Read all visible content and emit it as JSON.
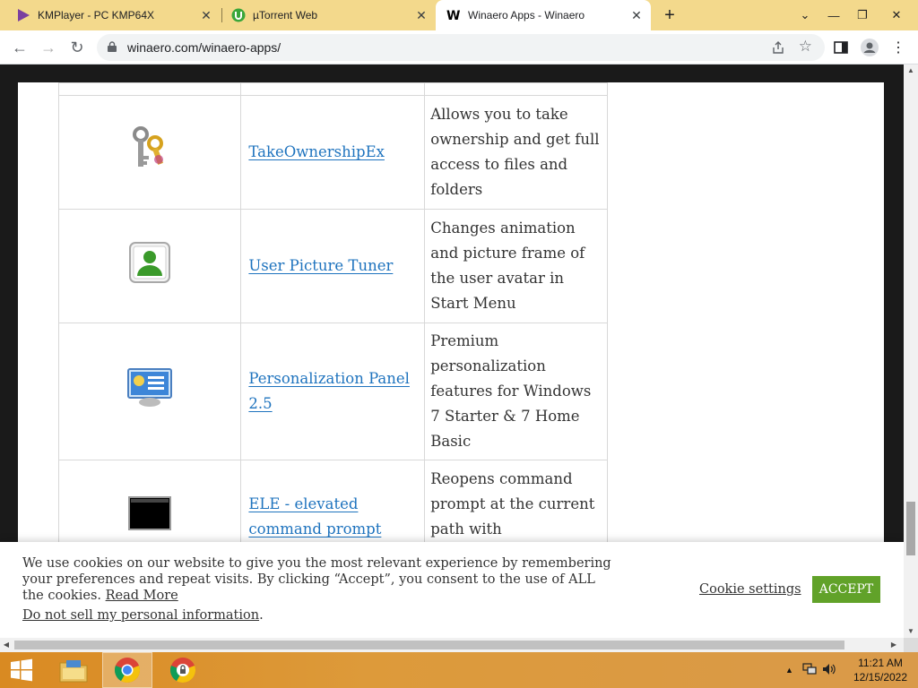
{
  "browser": {
    "tabs": [
      {
        "title": "KMPlayer - PC KMP64X",
        "icon": "kmplayer-icon",
        "active": false
      },
      {
        "title": "µTorrent Web",
        "icon": "utorrent-icon",
        "active": false
      },
      {
        "title": "Winaero Apps - Winaero",
        "icon": "winaero-icon",
        "active": true
      }
    ],
    "new_tab_glyph": "+",
    "url": "winaero.com/winaero-apps/"
  },
  "apps": [
    {
      "name": "TakeOwnershipEx",
      "icon": "keys-icon",
      "description": "Allows you to take ownership and get full access to files and folders"
    },
    {
      "name": "User Picture Tuner",
      "icon": "user-avatar-icon",
      "description": "Changes animation and picture frame of the user avatar in Start Menu"
    },
    {
      "name": "Personalization Panel 2.5",
      "icon": "personalization-panel-icon",
      "description": "Premium personalization features for Windows 7 Starter & 7 Home Basic"
    },
    {
      "name": "ELE - elevated command prompt",
      "icon": "command-prompt-icon",
      "description": "Reopens command prompt at the current path with administrator rights"
    }
  ],
  "cookie_banner": {
    "message": "We use cookies on our website to give you the most relevant experience by remembering your preferences and repeat visits. By clicking “Accept”, you consent to the use of ALL the cookies.",
    "read_more": "Read More",
    "do_not_sell": "Do not sell my personal information",
    "do_not_sell_suffix": ".",
    "settings_label": "Cookie settings",
    "accept_label": "ACCEPT"
  },
  "taskbar": {
    "time": "11:21 AM",
    "date": "12/15/2022"
  },
  "colors": {
    "tabstrip": "#f3d98c",
    "link": "#1e73be",
    "accept_button": "#61a229",
    "taskbar": "#d98a22"
  }
}
